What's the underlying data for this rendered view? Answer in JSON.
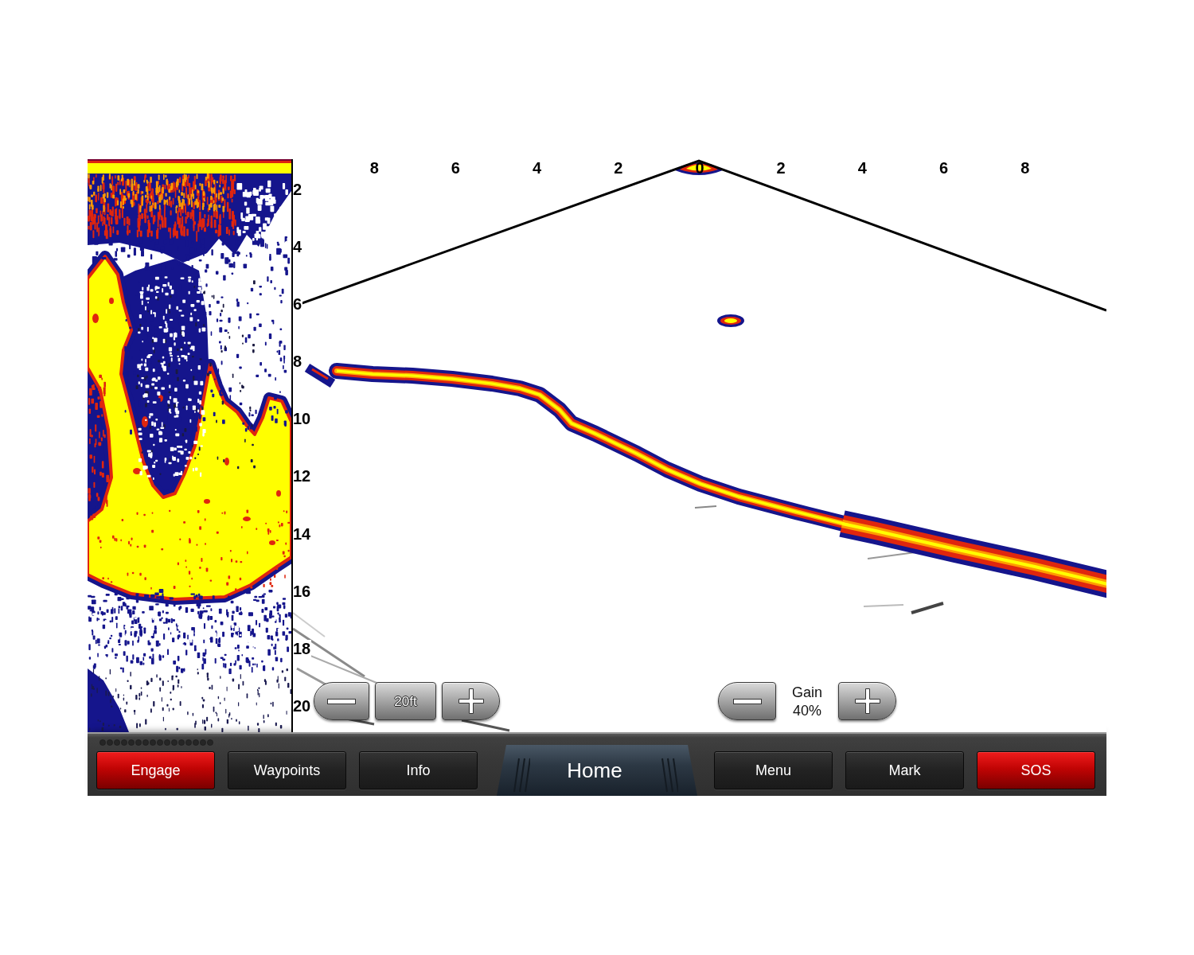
{
  "sonar": {
    "range_marks": [
      "8",
      "6",
      "4",
      "2",
      "0",
      "2",
      "4",
      "6",
      "8"
    ],
    "depth_marks": [
      "2",
      "4",
      "6",
      "8",
      "10",
      "12",
      "14",
      "16",
      "18",
      "20"
    ]
  },
  "range_control": {
    "value": "20ft"
  },
  "gain_control": {
    "label": "Gain",
    "value": "40%"
  },
  "bottom_bar": {
    "buttons": [
      {
        "label": "Engage",
        "kind": "alert"
      },
      {
        "label": "Waypoints",
        "kind": "plain"
      },
      {
        "label": "Info",
        "kind": "plain"
      },
      {
        "label": "Home",
        "kind": "home"
      },
      {
        "label": "Menu",
        "kind": "plain"
      },
      {
        "label": "Mark",
        "kind": "plain"
      },
      {
        "label": "SOS",
        "kind": "alert"
      }
    ]
  }
}
